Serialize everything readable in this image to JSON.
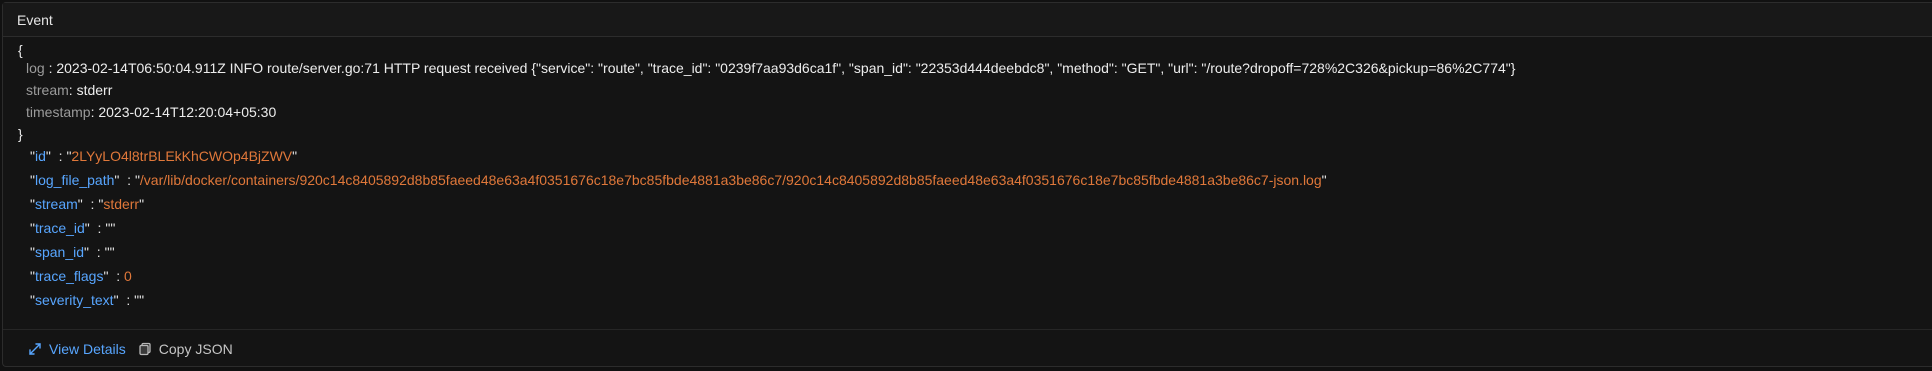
{
  "header": {
    "title": "Event"
  },
  "json_view": {
    "open_brace": "{",
    "close_brace": "}",
    "log_fields": [
      {
        "key": "log",
        "value": "2023-02-14T06:50:04.911Z INFO route/server.go:71 HTTP request received {\"service\": \"route\", \"trace_id\": \"0239f7aa93d6ca1f\", \"span_id\": \"22353d444deebdc8\", \"method\": \"GET\", \"url\": \"/route?dropoff=728%2C326&pickup=86%2C774\"}"
      },
      {
        "key": "stream",
        "value": "stderr"
      },
      {
        "key": "timestamp",
        "value": "2023-02-14T12:20:04+05:30"
      }
    ],
    "attributes": [
      {
        "key": "id",
        "value": "2LYyLO4l8trBLEkKhCWOp4BjZWV",
        "type": "string"
      },
      {
        "key": "log_file_path",
        "value": "/var/lib/docker/containers/920c14c8405892d8b85faeed48e63a4f0351676c18e7bc85fbde4881a3be86c7/920c14c8405892d8b85faeed48e63a4f0351676c18e7bc85fbde4881a3be86c7-json.log",
        "type": "string"
      },
      {
        "key": "stream",
        "value": "stderr",
        "type": "string"
      },
      {
        "key": "trace_id",
        "value": "",
        "type": "string"
      },
      {
        "key": "span_id",
        "value": "",
        "type": "string"
      },
      {
        "key": "trace_flags",
        "value": "0",
        "type": "number"
      },
      {
        "key": "severity_text",
        "value": "",
        "type": "string"
      }
    ]
  },
  "footer": {
    "view_details_label": "View Details",
    "copy_json_label": "Copy JSON"
  },
  "colors": {
    "accent_blue": "#58a6ff",
    "value_orange": "#e0783a"
  },
  "icons": {
    "view_details": "expand-arrows-icon",
    "copy_json": "copy-icon"
  }
}
